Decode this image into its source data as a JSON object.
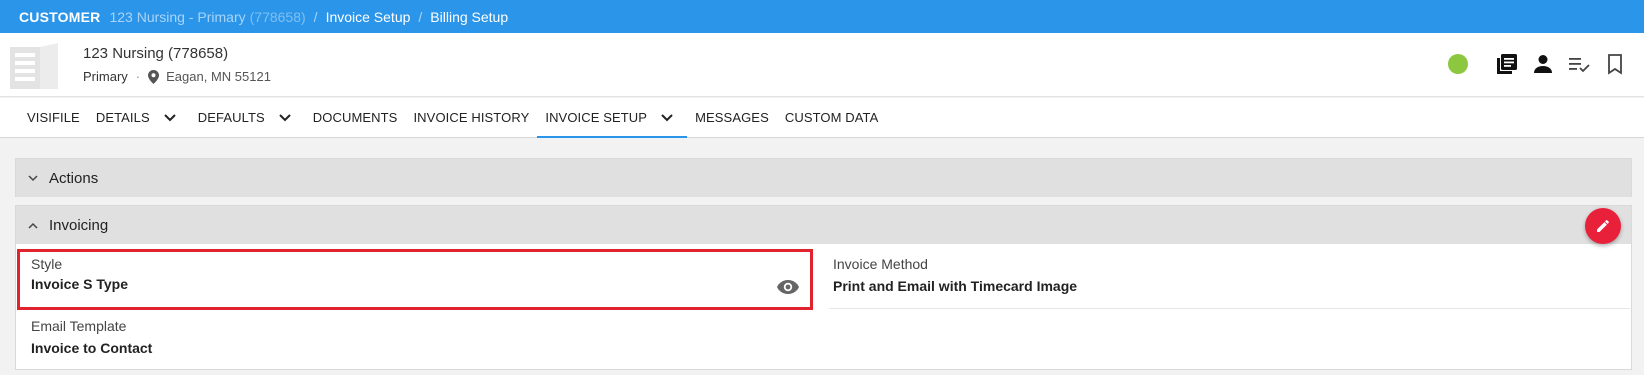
{
  "breadcrumb": {
    "root": "CUSTOMER",
    "customer": "123 Nursing - Primary",
    "customer_id": "(778658)",
    "separator": "/",
    "step1": "Invoice Setup",
    "step2": "Billing Setup"
  },
  "header": {
    "name": "123 Nursing (778658)",
    "type": "Primary",
    "dot": "·",
    "location": "Eagan, MN 55121",
    "status_color": "#8dc63f",
    "icons": [
      "building-icon",
      "status-dot",
      "library-icon",
      "person-icon",
      "checklist-icon",
      "bookmark-icon"
    ]
  },
  "tabs": [
    {
      "label": "VISIFILE"
    },
    {
      "label": "DETAILS"
    },
    {
      "label": "DEFAULTS"
    },
    {
      "label": "DOCUMENTS"
    },
    {
      "label": "INVOICE HISTORY"
    },
    {
      "label": "INVOICE SETUP"
    },
    {
      "label": "MESSAGES"
    },
    {
      "label": "CUSTOM DATA"
    }
  ],
  "panels": {
    "actions_title": "Actions",
    "invoicing_title": "Invoicing"
  },
  "fields": {
    "style_label": "Style",
    "style_value": "Invoice S Type",
    "method_label": "Invoice Method",
    "method_value": "Print and Email with Timecard Image",
    "email_label": "Email Template",
    "email_value": "Invoice to Contact"
  },
  "colors": {
    "accent": "#2b95ea",
    "highlight": "#e0232f",
    "fab": "#e8203a"
  }
}
